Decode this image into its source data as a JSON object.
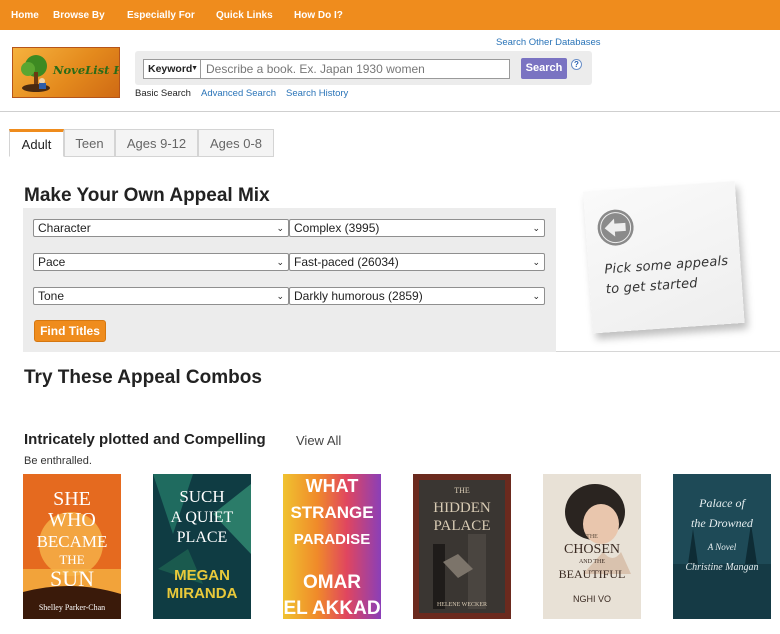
{
  "nav": {
    "items": [
      "Home",
      "Browse By",
      "Especially For",
      "Quick Links",
      "How Do I?"
    ]
  },
  "header": {
    "logo_text": "NoveList Plus",
    "search_other": "Search Other Databases",
    "keyword_label": "Keyword",
    "search_placeholder": "Describe a book. Ex. Japan 1930 women",
    "search_button": "Search",
    "help": "?",
    "links": [
      "Basic Search",
      "Advanced Search",
      "Search History"
    ]
  },
  "tabs": [
    "Adult",
    "Teen",
    "Ages 9-12",
    "Ages 0-8"
  ],
  "appeal_mix": {
    "title": "Make Your Own Appeal Mix",
    "rows": [
      {
        "category": "Character",
        "value": "Complex (3995)"
      },
      {
        "category": "Pace",
        "value": "Fast-paced (26034)"
      },
      {
        "category": "Tone",
        "value": "Darkly humorous (2859)"
      }
    ],
    "button": "Find Titles"
  },
  "note": {
    "line1": "Pick some appeals",
    "line2": "to get started"
  },
  "combos": {
    "title": "Try These Appeal Combos",
    "section_title": "Intricately plotted and Compelling",
    "view_all": "View All",
    "description": "Be enthralled."
  },
  "books": [
    {
      "title_lines": [
        "SHE",
        "WHO",
        "BECAME",
        "THE",
        "SUN"
      ],
      "author": "Shelley Parker-Chan"
    },
    {
      "title_lines": [
        "SUCH",
        "A QUIET",
        "PLACE"
      ],
      "author_lines": [
        "MEGAN",
        "MIRANDA"
      ]
    },
    {
      "title_lines": [
        "WHAT",
        "STRANGE",
        "PARADISE"
      ],
      "author_lines": [
        "OMAR",
        "EL AKKAD"
      ]
    },
    {
      "title_lines": [
        "THE",
        "HIDDEN",
        "PALACE"
      ],
      "author": "HELENE WECKER"
    },
    {
      "title_lines": [
        "THE",
        "CHOSEN",
        "AND THE",
        "BEAUTIFUL"
      ],
      "author": "NGHI VO"
    },
    {
      "title_lines": [
        "Palace of",
        "the Drowned"
      ],
      "subtitle": "A Novel",
      "author": "Christine Mangan"
    }
  ],
  "colors": {
    "brand_orange": "#ef8c1d",
    "search_button": "#7a73c2",
    "link_blue": "#2a74b8"
  }
}
